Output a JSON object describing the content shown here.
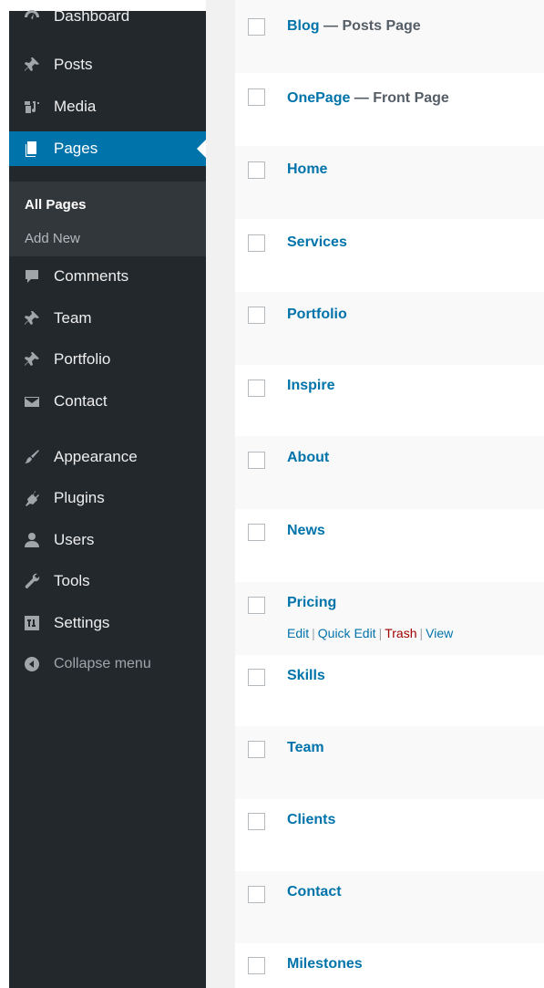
{
  "sidebar": {
    "items": [
      {
        "label": "Dashboard",
        "icon": "dashboard-icon"
      },
      {
        "label": "Posts",
        "icon": "pin-icon"
      },
      {
        "label": "Media",
        "icon": "media-icon"
      },
      {
        "label": "Pages",
        "icon": "pages-icon"
      },
      {
        "label": "Comments",
        "icon": "comment-icon"
      },
      {
        "label": "Team",
        "icon": "pin-icon"
      },
      {
        "label": "Portfolio",
        "icon": "pin-icon"
      },
      {
        "label": "Contact",
        "icon": "envelope-icon"
      },
      {
        "label": "Appearance",
        "icon": "paintbrush-icon"
      },
      {
        "label": "Plugins",
        "icon": "plugin-icon"
      },
      {
        "label": "Users",
        "icon": "user-icon"
      },
      {
        "label": "Tools",
        "icon": "wrench-icon"
      },
      {
        "label": "Settings",
        "icon": "settings-icon"
      },
      {
        "label": "Collapse menu",
        "icon": "collapse-icon"
      }
    ],
    "submenu": [
      {
        "label": "All Pages"
      },
      {
        "label": "Add New"
      }
    ]
  },
  "pages": {
    "rows": [
      {
        "title": "Blog",
        "state": " — Posts Page"
      },
      {
        "title": "OnePage",
        "state": " — Front Page"
      },
      {
        "title": "Home",
        "state": ""
      },
      {
        "title": "Services",
        "state": ""
      },
      {
        "title": "Portfolio",
        "state": ""
      },
      {
        "title": "Inspire",
        "state": ""
      },
      {
        "title": "About",
        "state": ""
      },
      {
        "title": "News",
        "state": ""
      },
      {
        "title": "Pricing",
        "state": ""
      },
      {
        "title": "Skills",
        "state": ""
      },
      {
        "title": "Team",
        "state": ""
      },
      {
        "title": "Clients",
        "state": ""
      },
      {
        "title": "Contact",
        "state": ""
      },
      {
        "title": "Milestones",
        "state": ""
      }
    ],
    "row_actions": {
      "edit": "Edit",
      "quick_edit": "Quick Edit",
      "trash": "Trash",
      "view": "View",
      "separator": "|"
    }
  },
  "colors": {
    "sidebar_bg": "#23282d",
    "active_bg": "#0073aa",
    "link": "#0073aa",
    "trash": "#a00000"
  }
}
